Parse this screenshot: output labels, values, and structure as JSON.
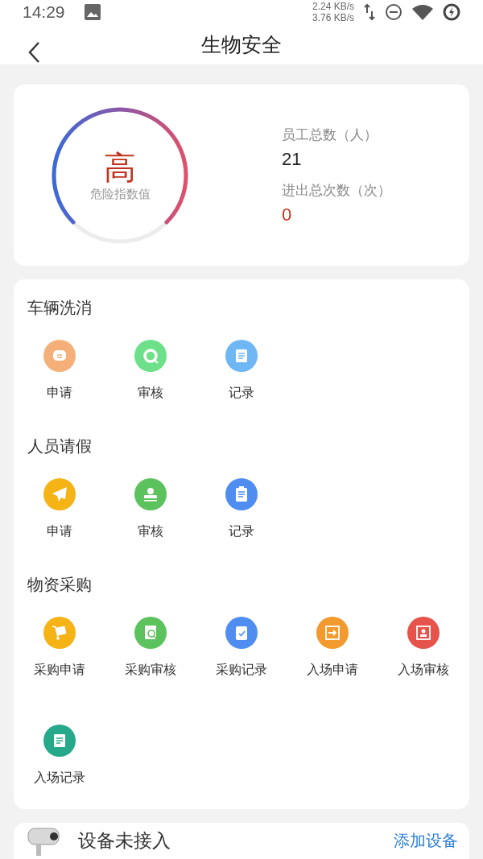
{
  "status_bar": {
    "time": "14:29",
    "speed_up": "2.24 KB/s",
    "speed_down": "3.76 KB/s"
  },
  "header": {
    "title": "生物安全"
  },
  "summary": {
    "risk": {
      "value": "高",
      "label": "危险指数值"
    },
    "stats": [
      {
        "label": "员工总数（人）",
        "value": "21",
        "kind": "normal"
      },
      {
        "label": "进出总次数（次）",
        "value": "0",
        "kind": "alert"
      }
    ]
  },
  "sections": [
    {
      "title": "车辆洗消",
      "items": [
        {
          "label": "申请",
          "kind": "chat",
          "color": "#f5b07a"
        },
        {
          "label": "审核",
          "kind": "lens",
          "color": "#6ee08a"
        },
        {
          "label": "记录",
          "kind": "notepad",
          "color": "#6fb6f5"
        }
      ]
    },
    {
      "title": "人员请假",
      "items": [
        {
          "label": "申请",
          "kind": "plane",
          "color": "#f5b316"
        },
        {
          "label": "审核",
          "kind": "stamp",
          "color": "#5cc25d"
        },
        {
          "label": "记录",
          "kind": "clipboard",
          "color": "#4f8ef0"
        }
      ]
    },
    {
      "title": "物资采购",
      "items": [
        {
          "label": "采购申请",
          "kind": "cart",
          "color": "#f5b316"
        },
        {
          "label": "采购审核",
          "kind": "docsearch",
          "color": "#5cc25d"
        },
        {
          "label": "采购记录",
          "kind": "check",
          "color": "#4f8ef0"
        },
        {
          "label": "入场申请",
          "kind": "enter",
          "color": "#f29a2e"
        },
        {
          "label": "入场审核",
          "kind": "badge",
          "color": "#e5534b"
        },
        {
          "label": "入场记录",
          "kind": "doc",
          "color": "#26a98b"
        }
      ]
    }
  ],
  "device": {
    "status": "设备未接入",
    "action": "添加设备"
  }
}
